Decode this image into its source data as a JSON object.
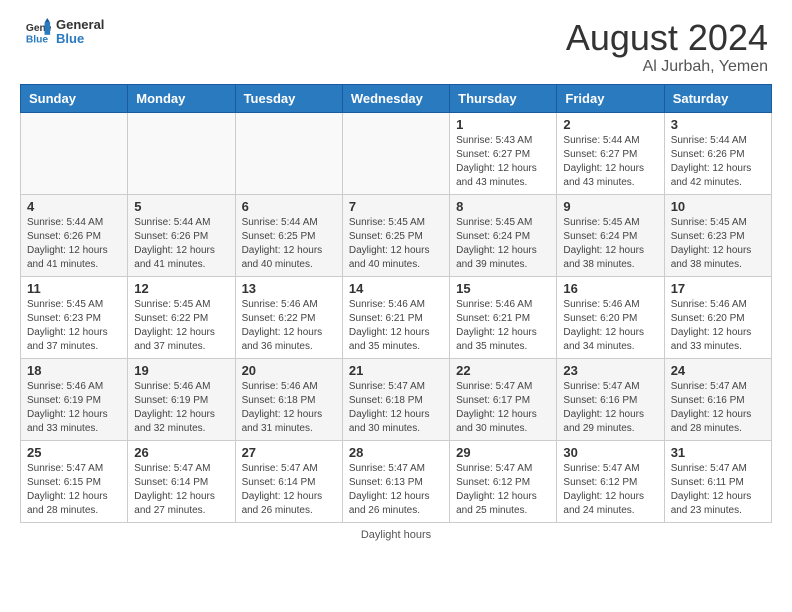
{
  "header": {
    "logo_line1": "General",
    "logo_line2": "Blue",
    "month": "August 2024",
    "location": "Al Jurbah, Yemen"
  },
  "weekdays": [
    "Sunday",
    "Monday",
    "Tuesday",
    "Wednesday",
    "Thursday",
    "Friday",
    "Saturday"
  ],
  "footer": "Daylight hours",
  "weeks": [
    [
      {
        "day": "",
        "info": ""
      },
      {
        "day": "",
        "info": ""
      },
      {
        "day": "",
        "info": ""
      },
      {
        "day": "",
        "info": ""
      },
      {
        "day": "1",
        "info": "Sunrise: 5:43 AM\nSunset: 6:27 PM\nDaylight: 12 hours and 43 minutes."
      },
      {
        "day": "2",
        "info": "Sunrise: 5:44 AM\nSunset: 6:27 PM\nDaylight: 12 hours and 43 minutes."
      },
      {
        "day": "3",
        "info": "Sunrise: 5:44 AM\nSunset: 6:26 PM\nDaylight: 12 hours and 42 minutes."
      }
    ],
    [
      {
        "day": "4",
        "info": "Sunrise: 5:44 AM\nSunset: 6:26 PM\nDaylight: 12 hours and 41 minutes."
      },
      {
        "day": "5",
        "info": "Sunrise: 5:44 AM\nSunset: 6:26 PM\nDaylight: 12 hours and 41 minutes."
      },
      {
        "day": "6",
        "info": "Sunrise: 5:44 AM\nSunset: 6:25 PM\nDaylight: 12 hours and 40 minutes."
      },
      {
        "day": "7",
        "info": "Sunrise: 5:45 AM\nSunset: 6:25 PM\nDaylight: 12 hours and 40 minutes."
      },
      {
        "day": "8",
        "info": "Sunrise: 5:45 AM\nSunset: 6:24 PM\nDaylight: 12 hours and 39 minutes."
      },
      {
        "day": "9",
        "info": "Sunrise: 5:45 AM\nSunset: 6:24 PM\nDaylight: 12 hours and 38 minutes."
      },
      {
        "day": "10",
        "info": "Sunrise: 5:45 AM\nSunset: 6:23 PM\nDaylight: 12 hours and 38 minutes."
      }
    ],
    [
      {
        "day": "11",
        "info": "Sunrise: 5:45 AM\nSunset: 6:23 PM\nDaylight: 12 hours and 37 minutes."
      },
      {
        "day": "12",
        "info": "Sunrise: 5:45 AM\nSunset: 6:22 PM\nDaylight: 12 hours and 37 minutes."
      },
      {
        "day": "13",
        "info": "Sunrise: 5:46 AM\nSunset: 6:22 PM\nDaylight: 12 hours and 36 minutes."
      },
      {
        "day": "14",
        "info": "Sunrise: 5:46 AM\nSunset: 6:21 PM\nDaylight: 12 hours and 35 minutes."
      },
      {
        "day": "15",
        "info": "Sunrise: 5:46 AM\nSunset: 6:21 PM\nDaylight: 12 hours and 35 minutes."
      },
      {
        "day": "16",
        "info": "Sunrise: 5:46 AM\nSunset: 6:20 PM\nDaylight: 12 hours and 34 minutes."
      },
      {
        "day": "17",
        "info": "Sunrise: 5:46 AM\nSunset: 6:20 PM\nDaylight: 12 hours and 33 minutes."
      }
    ],
    [
      {
        "day": "18",
        "info": "Sunrise: 5:46 AM\nSunset: 6:19 PM\nDaylight: 12 hours and 33 minutes."
      },
      {
        "day": "19",
        "info": "Sunrise: 5:46 AM\nSunset: 6:19 PM\nDaylight: 12 hours and 32 minutes."
      },
      {
        "day": "20",
        "info": "Sunrise: 5:46 AM\nSunset: 6:18 PM\nDaylight: 12 hours and 31 minutes."
      },
      {
        "day": "21",
        "info": "Sunrise: 5:47 AM\nSunset: 6:18 PM\nDaylight: 12 hours and 30 minutes."
      },
      {
        "day": "22",
        "info": "Sunrise: 5:47 AM\nSunset: 6:17 PM\nDaylight: 12 hours and 30 minutes."
      },
      {
        "day": "23",
        "info": "Sunrise: 5:47 AM\nSunset: 6:16 PM\nDaylight: 12 hours and 29 minutes."
      },
      {
        "day": "24",
        "info": "Sunrise: 5:47 AM\nSunset: 6:16 PM\nDaylight: 12 hours and 28 minutes."
      }
    ],
    [
      {
        "day": "25",
        "info": "Sunrise: 5:47 AM\nSunset: 6:15 PM\nDaylight: 12 hours and 28 minutes."
      },
      {
        "day": "26",
        "info": "Sunrise: 5:47 AM\nSunset: 6:14 PM\nDaylight: 12 hours and 27 minutes."
      },
      {
        "day": "27",
        "info": "Sunrise: 5:47 AM\nSunset: 6:14 PM\nDaylight: 12 hours and 26 minutes."
      },
      {
        "day": "28",
        "info": "Sunrise: 5:47 AM\nSunset: 6:13 PM\nDaylight: 12 hours and 26 minutes."
      },
      {
        "day": "29",
        "info": "Sunrise: 5:47 AM\nSunset: 6:12 PM\nDaylight: 12 hours and 25 minutes."
      },
      {
        "day": "30",
        "info": "Sunrise: 5:47 AM\nSunset: 6:12 PM\nDaylight: 12 hours and 24 minutes."
      },
      {
        "day": "31",
        "info": "Sunrise: 5:47 AM\nSunset: 6:11 PM\nDaylight: 12 hours and 23 minutes."
      }
    ]
  ]
}
